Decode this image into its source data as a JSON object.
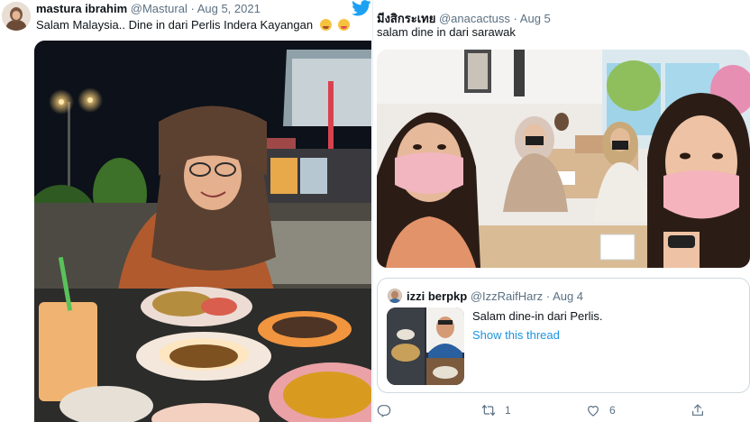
{
  "left_tweet": {
    "author_name": "mastura ibrahim",
    "handle": "@Mastural",
    "separator": "·",
    "date": "Aug 5, 2021",
    "text": "Salam Malaysia.. Dine in dari Perlis Indera Kayangan",
    "emojis": [
      "smiling-face-with-hand-over-mouth",
      "face-savoring-food"
    ],
    "photo_description_icon": "food-photo"
  },
  "right_tweet": {
    "author_name": "มีงสิกระเทย",
    "handle": "@anacactuss",
    "separator": "·",
    "date": "Aug 5",
    "text": "salam dine in dari sarawak",
    "quote": {
      "author_name": "izzi berpkp",
      "handle": "@IzzRaifHarz",
      "separator": "·",
      "date": "Aug 4",
      "text": "Salam dine-in dari Perlis.",
      "link": "Show this thread"
    },
    "actions": {
      "reply_count": "",
      "retweet_count": "1",
      "like_count": "6",
      "share_count": ""
    }
  },
  "colors": {
    "accent": "#1b95e0",
    "text": "#0f1419",
    "muted": "#5b7083",
    "border": "#cfd9de"
  }
}
